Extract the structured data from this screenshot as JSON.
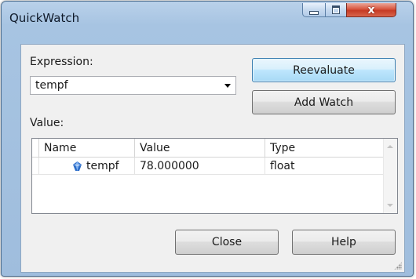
{
  "window": {
    "title": "QuickWatch",
    "close_glyph": "x"
  },
  "expression": {
    "label": "Expression:",
    "value": "tempf"
  },
  "buttons": {
    "reevaluate": "Reevaluate",
    "add_watch": "Add Watch",
    "close": "Close",
    "help": "Help"
  },
  "value_section": {
    "label": "Value:",
    "columns": [
      "Name",
      "Value",
      "Type"
    ],
    "rows": [
      {
        "name": "tempf",
        "value": "78.000000",
        "type": "float",
        "icon": "variable-gem-icon"
      }
    ]
  },
  "colors": {
    "title_bar": "#b9d1ea",
    "close_button": "#c63a24",
    "default_button": "#a7d9f5",
    "variable_icon": "#2b6cc8"
  }
}
